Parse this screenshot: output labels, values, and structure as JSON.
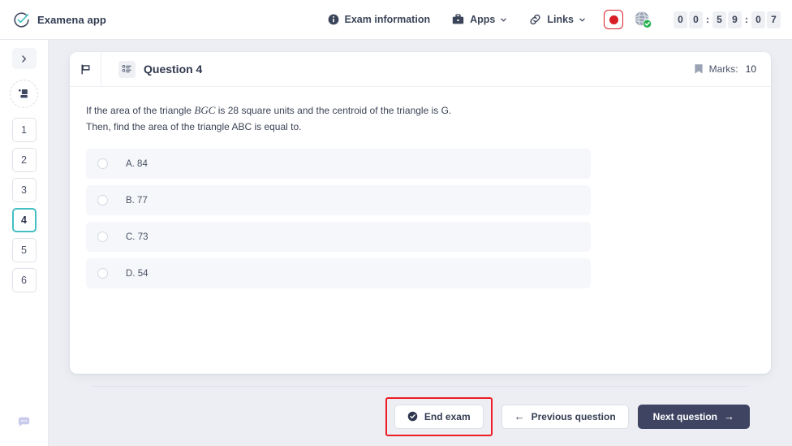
{
  "header": {
    "brand": "Examena app",
    "logo_icon": "check-circle-logo",
    "nav": [
      {
        "label": "Exam information",
        "icon": "info-icon",
        "has_chevron": false
      },
      {
        "label": "Apps",
        "icon": "briefcase-icon",
        "has_chevron": true
      },
      {
        "label": "Links",
        "icon": "link-icon",
        "has_chevron": true
      }
    ],
    "record_button": {
      "icon": "record-icon",
      "color": "#d81f26"
    },
    "network_status": {
      "icon": "globe-check-icon",
      "status_color": "#22b14c"
    },
    "timer": {
      "value": "00:59:07",
      "digits": [
        "0",
        "0",
        "5",
        "9",
        "0",
        "7"
      ],
      "separator": ":"
    }
  },
  "sidebar": {
    "expand_button": {
      "icon": "chevron-right-icon"
    },
    "section_badge": {
      "icon": "sections-icon"
    },
    "questions": [
      {
        "label": "1",
        "active": false
      },
      {
        "label": "2",
        "active": false
      },
      {
        "label": "3",
        "active": false
      },
      {
        "label": "4",
        "active": true
      },
      {
        "label": "5",
        "active": false
      },
      {
        "label": "6",
        "active": false
      }
    ],
    "chat_button": {
      "icon": "chat-bubble-icon",
      "color": "#c8cbec"
    }
  },
  "question_card": {
    "flag_icon": "flag-icon",
    "type_icon": "multiple-choice-icon",
    "title": "Question 4",
    "marks_icon": "bookmark-icon",
    "marks_label": "Marks:",
    "marks_value": "10",
    "text_part1": "If the area of the triangle ",
    "text_math": "BGC",
    "text_part2": " is 28 square units and the centroid of the triangle is G. Then, find the area of the triangle ABC is equal to.",
    "options": [
      {
        "label": "A. 84",
        "selected": false
      },
      {
        "label": "B. 77",
        "selected": false
      },
      {
        "label": "C. 73",
        "selected": false
      },
      {
        "label": "D. 54",
        "selected": false
      }
    ]
  },
  "footer": {
    "end_exam": {
      "label": "End exam",
      "icon": "check-circle-icon",
      "highlighted": true,
      "highlight_color": "#ee1c25"
    },
    "previous": {
      "label": "Previous question",
      "icon": "arrow-left-icon"
    },
    "next": {
      "label": "Next question",
      "icon": "arrow-right-icon",
      "color": "#3e4462"
    }
  }
}
